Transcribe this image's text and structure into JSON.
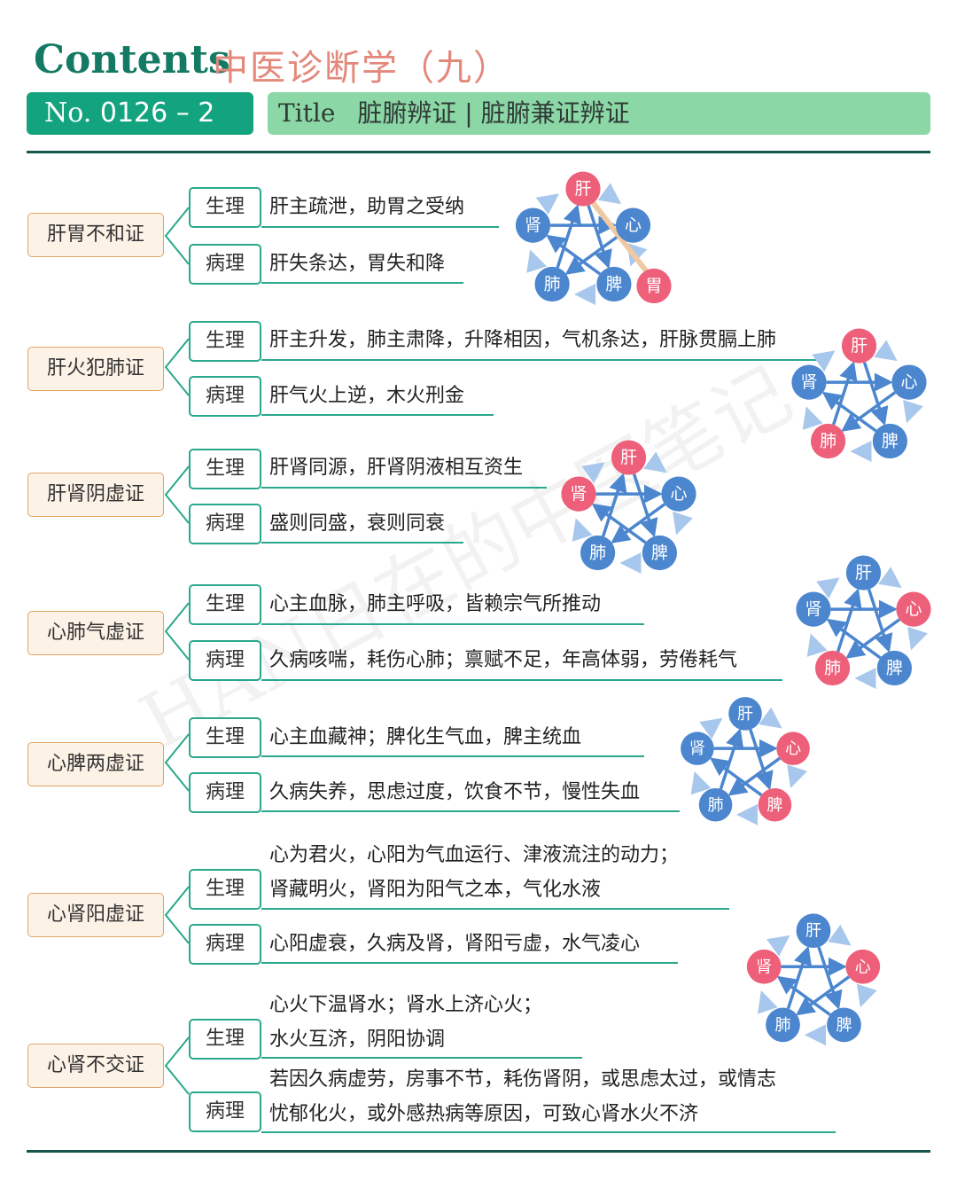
{
  "header": {
    "contents": "Contents",
    "subject": "中医诊断学（九）",
    "no_label": "No.",
    "no_value": "0126 – 2",
    "title_label": "Title",
    "title_value": "脏腑辨证 | 脏腑兼证辨证"
  },
  "watermark": "HAN日在的中医笔记",
  "labels": {
    "physiology": "生理",
    "pathology": "病理"
  },
  "sections": [
    {
      "name": "肝胃不和证",
      "physiology": [
        "肝主疏泄，助胃之受纳"
      ],
      "pathology": [
        "肝失条达，胃失和降"
      ]
    },
    {
      "name": "肝火犯肺证",
      "physiology": [
        "肝主升发，肺主肃降，升降相因，气机条达，肝脉贯膈上肺"
      ],
      "pathology": [
        "肝气火上逆，木火刑金"
      ]
    },
    {
      "name": "肝肾阴虚证",
      "physiology": [
        "肝肾同源，肝肾阴液相互资生"
      ],
      "pathology": [
        "盛则同盛，衰则同衰"
      ]
    },
    {
      "name": "心肺气虚证",
      "physiology": [
        "心主血脉，肺主呼吸，皆赖宗气所推动"
      ],
      "pathology": [
        "久病咳喘，耗伤心肺；禀赋不足，年高体弱，劳倦耗气"
      ]
    },
    {
      "name": "心脾两虚证",
      "physiology": [
        "心主血藏神；脾化生气血，脾主统血"
      ],
      "pathology": [
        "久病失养，思虑过度，饮食不节，慢性失血"
      ]
    },
    {
      "name": "心肾阳虚证",
      "physiology": [
        "心为君火，心阳为气血运行、津液流注的动力；",
        "肾藏明火，肾阳为阳气之本，气化水液"
      ],
      "pathology": [
        "心阳虚衰，久病及肾，肾阳亏虚，水气凌心"
      ]
    },
    {
      "name": "心肾不交证",
      "physiology": [
        "心火下温肾水；肾水上济心火；",
        "水火互济，阴阳协调"
      ],
      "pathology": [
        "若因久病虚劳，房事不节，耗伤肾阴，或思虑太过，或情志",
        "忧郁化火，或外感热病等原因，可致心肾水火不济"
      ]
    }
  ],
  "diagram_organs": {
    "liver": "肝",
    "heart": "心",
    "spleen": "脾",
    "lung": "肺",
    "kidney": "肾",
    "stomach": "胃"
  },
  "diagrams": [
    {
      "highlight": [
        "liver",
        "stomach"
      ],
      "extra": "stomach"
    },
    {
      "highlight": [
        "liver",
        "lung"
      ]
    },
    {
      "highlight": [
        "liver",
        "kidney"
      ]
    },
    {
      "highlight": [
        "heart",
        "lung"
      ]
    },
    {
      "highlight": [
        "heart",
        "spleen"
      ]
    },
    {
      "highlight": [
        "heart",
        "kidney"
      ]
    }
  ],
  "colors": {
    "accent_green": "#14a37f",
    "title_green": "#8cd7a6",
    "organ_blue": "#4b86cf",
    "organ_red": "#ee5f7a",
    "heading_red": "#e3887a"
  }
}
